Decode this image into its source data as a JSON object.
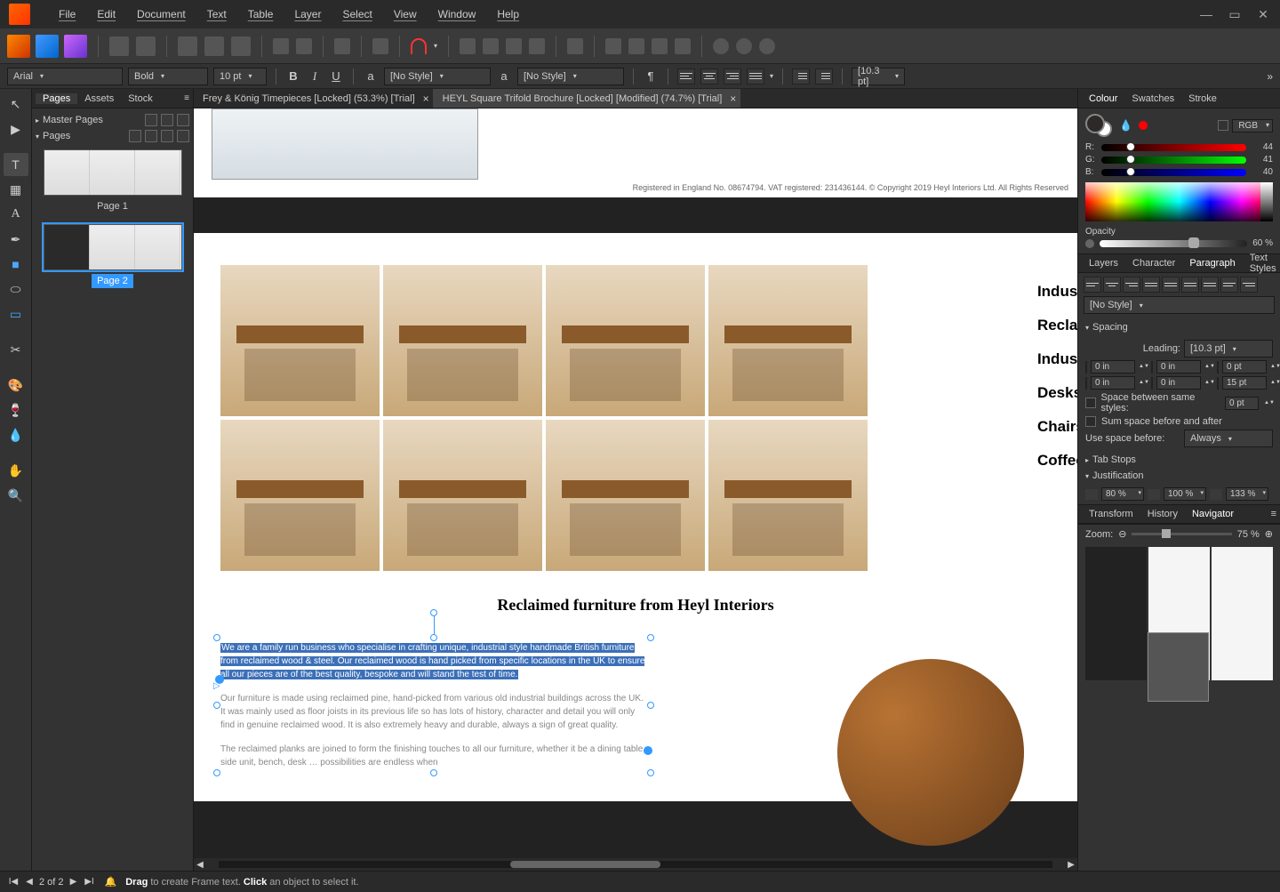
{
  "menus": [
    "File",
    "Edit",
    "Document",
    "Text",
    "Table",
    "Layer",
    "Select",
    "View",
    "Window",
    "Help"
  ],
  "font": {
    "family": "Arial",
    "weight": "Bold",
    "size": "10 pt",
    "char_style": "[No Style]",
    "para_style": "[No Style]",
    "leading_indicator": "[10.3 pt]"
  },
  "left_tabs": [
    "Pages",
    "Assets",
    "Stock"
  ],
  "left_active": "Pages",
  "pages": {
    "master": "Master Pages",
    "section": "Pages",
    "thumbs": [
      {
        "label": "Page 1"
      },
      {
        "label": "Page 2"
      }
    ]
  },
  "doc_tabs": [
    {
      "title": "Frey & König Timepieces [Locked] (53.3%) [Trial]"
    },
    {
      "title": "HEYL Square Trifold Brochure [Locked] [Modified] (74.7%) [Trial]",
      "active": true
    }
  ],
  "doc": {
    "top_footer": "Registered in England No. 08674794. VAT registered: 231436144. © Copyright 2019 Heyl Interiors Ltd. All Rights Reserved",
    "title": "Reclaimed furniture from Heyl Interiors",
    "categories": [
      "Industrial",
      "Reclaimed",
      "Industrial",
      "Desks",
      "Chairs &",
      "Coffee &"
    ],
    "para_highlight": "We are a family run business who specialise in crafting unique, industrial style handmade British furniture from reclaimed wood & steel. Our reclaimed wood is hand picked from specific locations in the UK to ensure all our pieces are of the best quality, bespoke and will stand the test of time.",
    "para2": "Our furniture is made using reclaimed pine, hand-picked from various old industrial buildings across the UK. It was mainly used as floor joists in its previous life so has lots of history, character and detail you will only find in genuine reclaimed wood. It is also extremely heavy and durable, always a sign of great quality.",
    "para3": "The reclaimed planks are joined to form the finishing touches to all our furniture, whether it be a dining table, side unit, bench, desk … possibilities are endless when"
  },
  "colour": {
    "tabs": [
      "Colour",
      "Swatches",
      "Stroke"
    ],
    "active": "Colour",
    "mode": "RGB",
    "r": 44,
    "g": 41,
    "b": 40,
    "opacity_label": "Opacity",
    "opacity": "60 %"
  },
  "text_tabs": [
    "Layers",
    "Character",
    "Paragraph",
    "Text Styles"
  ],
  "text_tab_active": "Paragraph",
  "paragraph": {
    "style": "[No Style]",
    "sections": {
      "spacing": "Spacing",
      "tab_stops": "Tab Stops",
      "justification": "Justification"
    },
    "leading_label": "Leading:",
    "leading": "[10.3 pt]",
    "sp1": "0 in",
    "sp2": "0 in",
    "sp3": "0 pt",
    "sp4": "0 in",
    "sp5": "0 in",
    "sp6": "15 pt",
    "same_styles": "Space between same styles:",
    "same_styles_val": "0 pt",
    "sum_before_after": "Sum space before and after",
    "use_space_before": "Use space before:",
    "use_space_val": "Always",
    "just": [
      "80 %",
      "100 %",
      "133 %"
    ]
  },
  "nav_tabs": [
    "Transform",
    "History",
    "Navigator"
  ],
  "nav_active": "Navigator",
  "nav": {
    "zoom_label": "Zoom:",
    "zoom": "75 %"
  },
  "status": {
    "page": "2 of 2",
    "drag": "Drag",
    "drag_rest": " to create Frame text. ",
    "click": "Click",
    "click_rest": " an object to select it."
  }
}
